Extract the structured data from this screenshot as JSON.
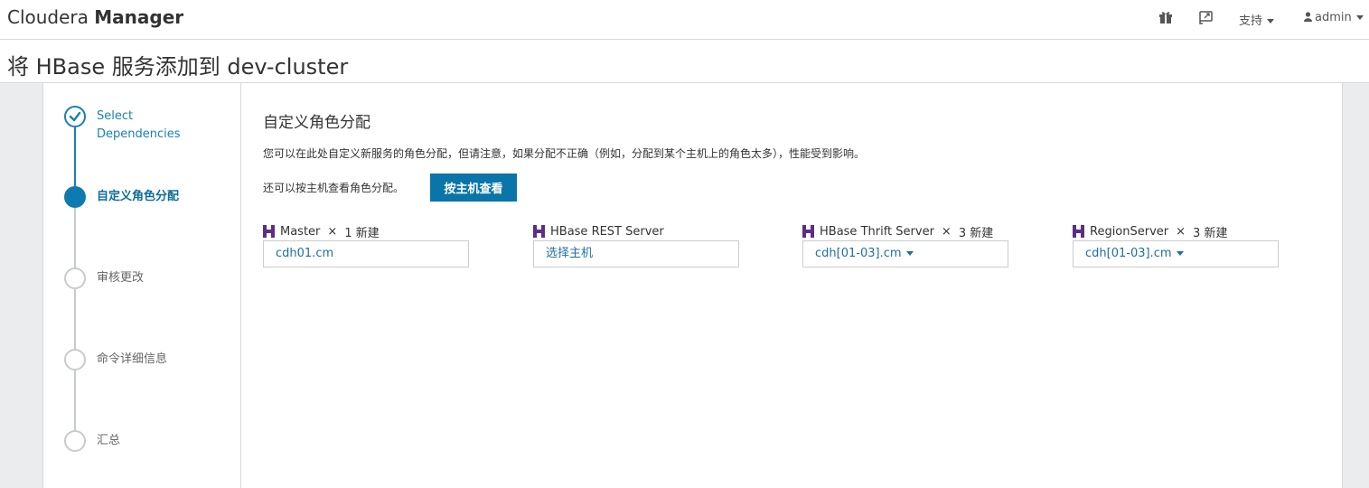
{
  "header": {
    "brand_light": "Cloudera",
    "brand_bold": "Manager",
    "icons": [
      "gift-icon",
      "cast-icon"
    ],
    "support_label": "支持",
    "user_label": "admin"
  },
  "page": {
    "title": "将 HBase 服务添加到 dev-cluster"
  },
  "wizard": {
    "steps": [
      {
        "label_line1": "Select",
        "label_line2": "Dependencies",
        "state": "done"
      },
      {
        "label": "自定义角色分配",
        "state": "active"
      },
      {
        "label": "审核更改",
        "state": "pending"
      },
      {
        "label": "命令详细信息",
        "state": "pending"
      },
      {
        "label": "汇总",
        "state": "pending"
      }
    ]
  },
  "main": {
    "title": "自定义角色分配",
    "description": "您可以在此处自定义新服务的角色分配，但请注意，如果分配不正确（例如，分配到某个主机上的角色太多），性能受到影响。",
    "view_by_host_text": "还可以按主机查看角色分配。",
    "view_by_host_button": "按主机查看",
    "roles": [
      {
        "name": "Master",
        "times": "×",
        "count": "1 新建",
        "value": "cdh01.cm",
        "has_dropdown": false
      },
      {
        "name": "HBase REST Server",
        "times": "",
        "count": "",
        "value": "选择主机",
        "has_dropdown": false
      },
      {
        "name": "HBase Thrift Server",
        "times": "×",
        "count": "3 新建",
        "value": "cdh[01-03].cm",
        "has_dropdown": true
      },
      {
        "name": "RegionServer",
        "times": "×",
        "count": "3 新建",
        "value": "cdh[01-03].cm",
        "has_dropdown": true
      }
    ]
  },
  "colors": {
    "accent": "#0a75a9",
    "active_step": "#0d7ab0",
    "link": "#1f6fa0",
    "hbase_icon": "#5b2e86"
  }
}
